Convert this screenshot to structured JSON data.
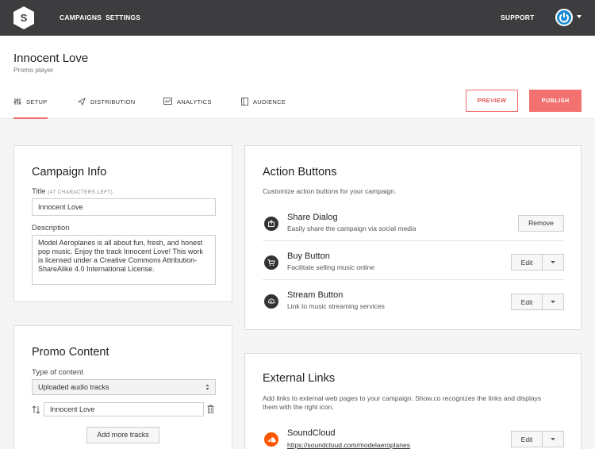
{
  "nav": {
    "campaigns": "CAMPAIGNS",
    "settings": "SETTINGS",
    "support": "SUPPORT",
    "logo_letter": "S"
  },
  "header": {
    "title": "Innocent Love",
    "subtitle": "Promo player",
    "tabs": [
      "SETUP",
      "DISTRIBUTION",
      "ANALYTICS",
      "AUDIENCE"
    ],
    "preview": "PREVIEW",
    "publish": "PUBLISH"
  },
  "campaign_info": {
    "title": "Campaign Info",
    "title_label": "Title",
    "title_hint": "(47 CHARACTERS LEFT)",
    "title_value": "Innocent Love",
    "description_label": "Description",
    "description_value": "Model Aeroplanes is all about fun, fresh, and honest pop music. Enjoy the track Innocent Love! This work is licensed under a Creative Commons Attribution-ShareAlike 4.0 International License."
  },
  "promo_content": {
    "title": "Promo Content",
    "type_label": "Type of content",
    "type_value": "Uploaded audio tracks",
    "track_value": "Innocent Love",
    "add_more": "Add more tracks"
  },
  "action_buttons": {
    "title": "Action Buttons",
    "intro": "Customize action buttons for your campaign.",
    "items": [
      {
        "name": "Share Dialog",
        "desc": "Easily share the campaign via social media",
        "button": "Remove"
      },
      {
        "name": "Buy Button",
        "desc": "Facilitate selling music online",
        "button": "Edit"
      },
      {
        "name": "Stream Button",
        "desc": "Link to music streaming services",
        "button": "Edit"
      }
    ]
  },
  "external_links": {
    "title": "External Links",
    "intro": "Add links to external web pages to your campaign. Show.co recognizes the links and displays them with the right icon.",
    "items": [
      {
        "name": "SoundCloud",
        "url": "https://soundcloud.com/modelaeroplanes",
        "button": "Edit"
      }
    ]
  },
  "colors": {
    "topbar": "#3d3d3f",
    "accent": "#f37171",
    "avatar": "#1a8ad4",
    "soundcloud": "#ff5500"
  }
}
